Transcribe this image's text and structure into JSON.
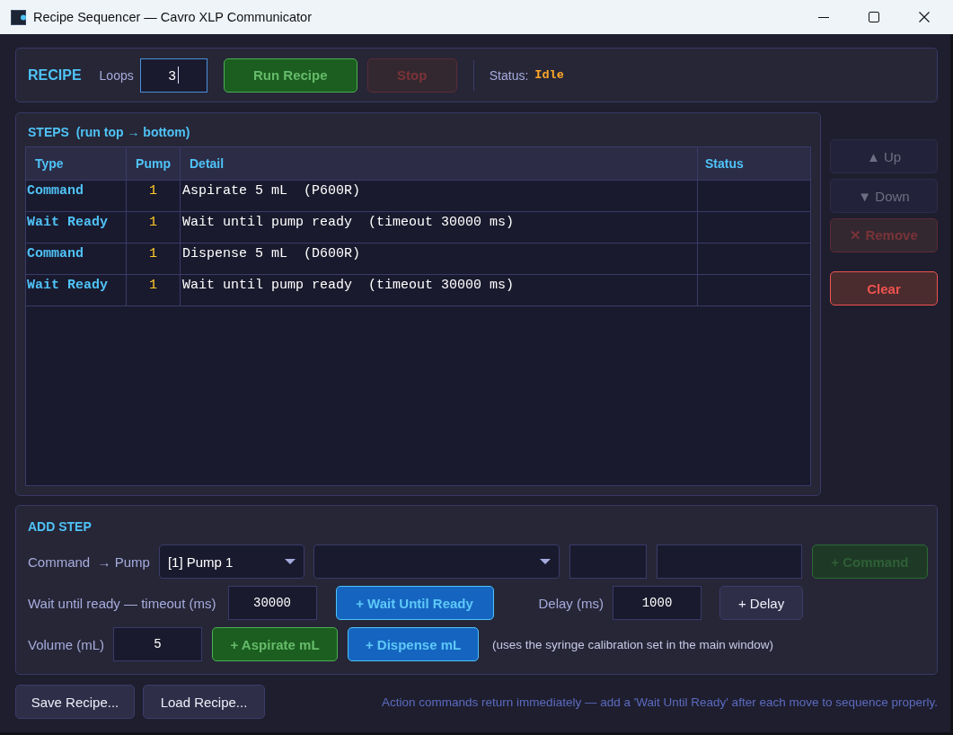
{
  "window": {
    "title": "Recipe Sequencer — Cavro XLP Communicator"
  },
  "recipe": {
    "heading": "RECIPE",
    "loops": {
      "label": "Loops",
      "value": "3",
      "focused": true
    },
    "buttons": [
      {
        "label": "Run Recipe",
        "kind": "confirm",
        "disabled": false
      },
      {
        "label": "Stop",
        "kind": "danger",
        "disabled": true
      }
    ],
    "status": {
      "label": "Status:",
      "value": "Idle"
    }
  },
  "steps": {
    "title": "STEPS  (run top → bottom)",
    "columns": [
      "Type",
      "Pump",
      "Detail",
      "Status"
    ],
    "rows": [
      {
        "type": "Command",
        "pump": "1",
        "detail": "Aspirate 5 mL  (P600R)"
      },
      {
        "type": "Wait Ready",
        "pump": "1",
        "detail": "Wait until pump ready  (timeout 30000 ms)"
      },
      {
        "type": "Command",
        "pump": "1",
        "detail": "Dispense 5 mL  (D600R)"
      },
      {
        "type": "Wait Ready",
        "pump": "1",
        "detail": "Wait until pump ready  (timeout 30000 ms)"
      }
    ]
  },
  "step_buttons": [
    {
      "label": "▲ Up",
      "kind": "plain",
      "disabled": true
    },
    {
      "label": "▼ Down",
      "kind": "plain",
      "disabled": true
    },
    {
      "label": "✕ Remove",
      "kind": "danger",
      "disabled": true
    },
    {
      "label": "Clear",
      "kind": "danger",
      "disabled": false
    }
  ],
  "add_step": {
    "title": "ADD STEP",
    "rows": [
      {
        "items": [
          {
            "kind": "label",
            "text": "Command  → Pump"
          },
          {
            "kind": "dropdown",
            "value": "[1] Pump 1"
          },
          {
            "kind": "dropdown"
          },
          {
            "kind": "input"
          },
          {
            "kind": "input"
          },
          {
            "kind": "confirm",
            "label": "+ Command",
            "disabled": true
          }
        ]
      },
      {
        "items": [
          {
            "kind": "label",
            "text": "Wait until ready — timeout (ms)"
          },
          {
            "kind": "input",
            "value": "30000"
          },
          {
            "kind": "action",
            "label": "+ Wait Until Ready",
            "disabled": false
          },
          {
            "kind": "label",
            "text": "Delay (ms)"
          },
          {
            "kind": "input",
            "value": "1000"
          },
          {
            "kind": "plain",
            "label": "+ Delay",
            "disabled": false
          }
        ]
      },
      {
        "items": [
          {
            "kind": "label",
            "text": "Volume (mL)"
          },
          {
            "kind": "input",
            "value": "5"
          },
          {
            "kind": "confirm",
            "label": "+ Aspirate mL",
            "disabled": false
          },
          {
            "kind": "action",
            "label": "+ Dispense mL",
            "disabled": false
          },
          {
            "kind": "note",
            "text": "(uses the syringe calibration set in the main window)"
          }
        ]
      }
    ]
  },
  "footer": {
    "buttons": [
      {
        "label": "Save Recipe..."
      },
      {
        "label": "Load Recipe..."
      }
    ],
    "note": "Action commands return immediately — add a 'Wait Until Ready' after each move to sequence properly."
  }
}
